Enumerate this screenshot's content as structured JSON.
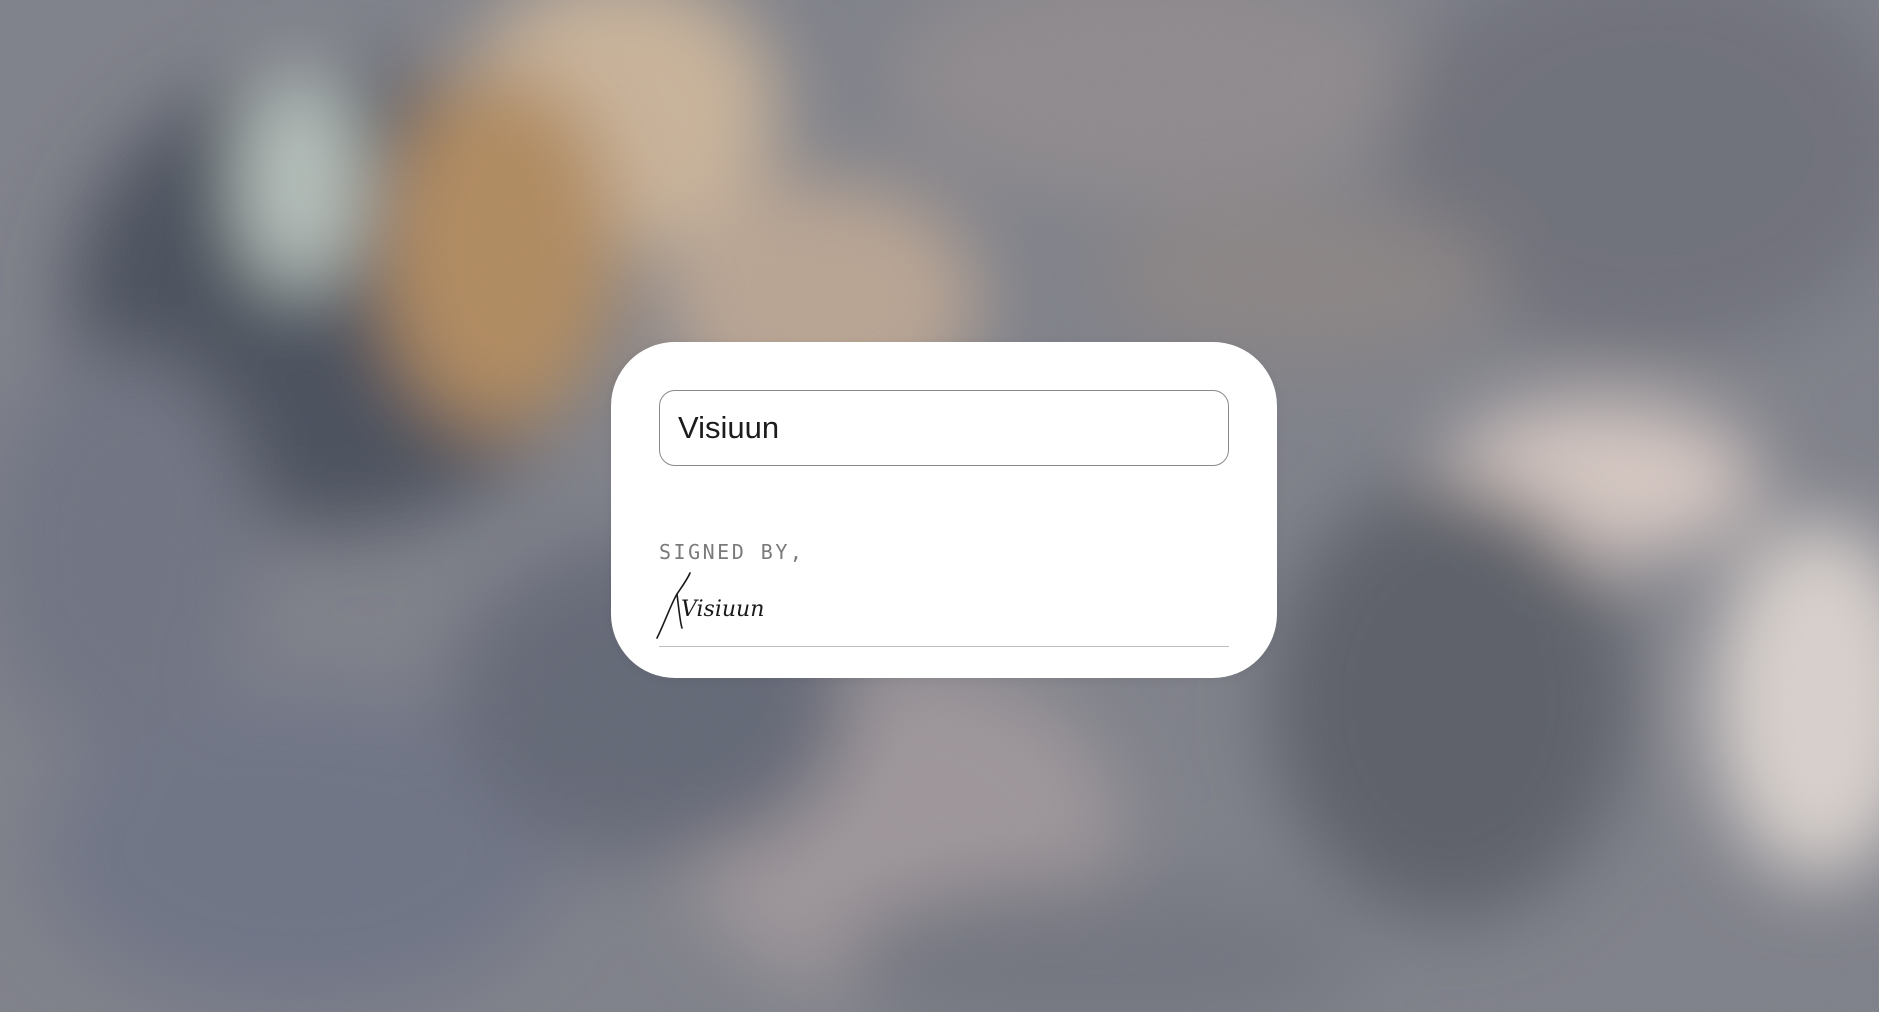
{
  "form": {
    "name_value": "Visiuun"
  },
  "signature": {
    "label": "SIGNED BY,",
    "name": "Visiuun"
  }
}
